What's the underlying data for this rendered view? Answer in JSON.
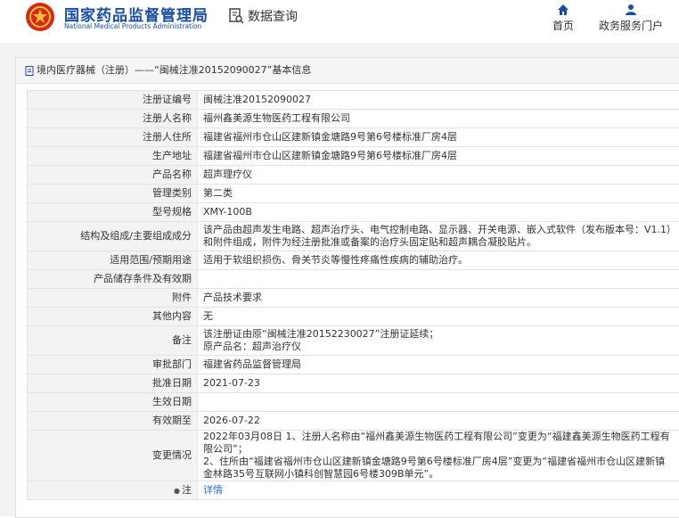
{
  "header": {
    "brand_cn": "国家药品监督管理局",
    "brand_en": "National Medical Products Administration",
    "query_label": "数据查询",
    "nav": [
      {
        "label": "首页",
        "icon": "home-icon"
      },
      {
        "label": "政务服务门户",
        "icon": "user-icon"
      }
    ]
  },
  "breadcrumb": "境内医疗器械（注册）——“闽械注准20152090027”基本信息",
  "rows": [
    {
      "label": "注册证编号",
      "value": "闽械注准20152090027"
    },
    {
      "label": "注册人名称",
      "value": "福州鑫美源生物医药工程有限公司"
    },
    {
      "label": "注册人住所",
      "value": "福建省福州市仓山区建新镇金塘路9号第6号楼标准厂房4层"
    },
    {
      "label": "生产地址",
      "value": "福建省福州市仓山区建新镇金塘路9号第6号楼标准厂房4层"
    },
    {
      "label": "产品名称",
      "value": "超声理疗仪"
    },
    {
      "label": "管理类别",
      "value": "第二类"
    },
    {
      "label": "型号规格",
      "value": "XMY-100B"
    },
    {
      "label": "结构及组成/主要组成成分",
      "value": "该产品由超声发生电路、超声治疗头、电气控制电路、显示器、开关电源、嵌入式软件（发布版本号：V1.1）和附件组成，附件为经注册批准或备案的治疗头固定贴和超声耦合凝胶贴片。"
    },
    {
      "label": "适用范围/预期用途",
      "value": "适用于软组织损伤、骨关节炎等慢性疼痛性疾病的辅助治疗。"
    },
    {
      "label": "产品储存条件及有效期",
      "value": ""
    },
    {
      "label": "附件",
      "value": "产品技术要求"
    },
    {
      "label": "其他内容",
      "value": "无"
    },
    {
      "label": "备注",
      "value": "该注册证由原“闽械注准20152230027”注册证延续；\n原产品名：超声治疗仪"
    },
    {
      "label": "审批部门",
      "value": "福建省药品监督管理局"
    },
    {
      "label": "批准日期",
      "value": "2021-07-23"
    },
    {
      "label": "生效日期",
      "value": ""
    },
    {
      "label": "有效期至",
      "value": "2026-07-22"
    },
    {
      "label": "变更情况",
      "value": "2022年03月08日 1、注册人名称由“福州鑫美源生物医药工程有限公司”变更为“福建鑫美源生物医药工程有限公司”；\n2、住所由“福建省福州市仓山区建新镇金塘路9号第6号楼标准厂房4层”变更为“福建省福州市仓山区建新镇金林路35号互联网小镇科创智慧园6号楼309B单元”。"
    }
  ],
  "note_row": {
    "label": "注",
    "link": "详情"
  },
  "colors": {
    "brand": "#1a4fa0",
    "emblem_red": "#d32a1e",
    "link": "#2a6fcb"
  }
}
